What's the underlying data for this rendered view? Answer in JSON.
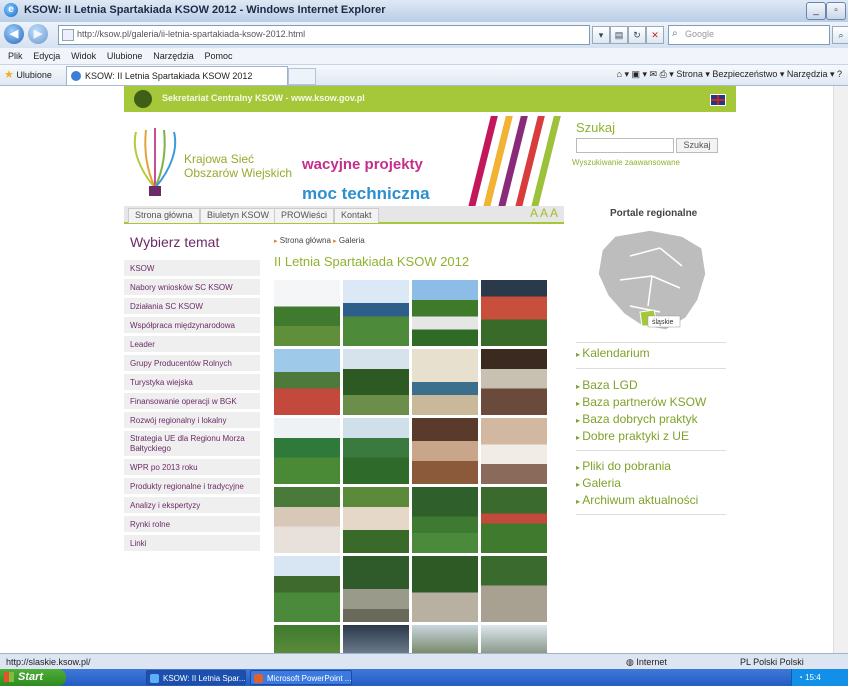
{
  "window": {
    "title": "KSOW: II Letnia Spartakiada KSOW 2012 - Windows Internet Explorer",
    "address": "http://ksow.pl/galeria/ii-letnia-spartakiada-ksow-2012.html",
    "search_placeholder": "Google",
    "menu": [
      "Plik",
      "Edycja",
      "Widok",
      "Ulubione",
      "Narzędzia",
      "Pomoc"
    ],
    "favorites_label": "Ulubione",
    "tab_title": "KSOW: II Letnia Spartakiada KSOW 2012",
    "command_bar": "Strona ▾  Bezpieczeństwo ▾  Narzędzia ▾"
  },
  "site": {
    "topbar_text": "Sekretariat Centralny KSOW - www.ksow.gov.pl",
    "org_line1": "Krajowa Sieć",
    "org_line2": "Obszarów Wiejskich",
    "banner_word1": "wacyjne projekty",
    "banner_word2": "moc techniczna",
    "nav": [
      "Strona główna",
      "Biuletyn KSOW",
      "PROWieści",
      "Kontakt"
    ],
    "font_sizer": "A A A",
    "left_heading": "Wybierz temat",
    "left_menu": [
      "KSOW",
      "Nabory wniosków SC KSOW",
      "Działania SC KSOW",
      "Współpraca międzynarodowa",
      "Leader",
      "Grupy Producentów Rolnych",
      "Turystyka wiejska",
      "Finansowanie operacji w BGK",
      "Rozwój regionalny i lokalny",
      "Strategia UE dla Regionu Morza Bałtyckiego",
      "WPR po 2013 roku",
      "Produkty regionalne i tradycyjne",
      "Analizy i ekspertyzy",
      "Rynki rolne",
      "Linki"
    ],
    "breadcrumb": [
      "Strona główna",
      "Galeria"
    ],
    "gallery_title": "II Letnia Spartakiada KSOW 2012",
    "search_label": "Szukaj",
    "search_button": "Szukaj",
    "advanced_search": "Wyszukiwanie zaawansowane",
    "portale_heading": "Portale regionalne",
    "map_region_label": "śląskie",
    "right_links_1": [
      "Kalendarium"
    ],
    "right_links_2": [
      "Baza LGD",
      "Baza partnerów KSOW",
      "Baza dobrych praktyk",
      "Dobre praktyki z UE"
    ],
    "right_links_3": [
      "Pliki do pobrania",
      "Galeria",
      "Archiwum aktualności"
    ]
  },
  "status": {
    "url": "http://slaskie.ksow.pl/",
    "zone": "Internet",
    "lang": "PL Polski   Polski"
  },
  "taskbar": {
    "start": "Start",
    "tasks": [
      "KSOW: II Letnia Spar...",
      "Microsoft PowerPoint ..."
    ],
    "clock": "15:4"
  },
  "colors": {
    "brand_green": "#a5c83a",
    "link_green": "#8fb22f",
    "menu_purple": "#6b2b66"
  }
}
